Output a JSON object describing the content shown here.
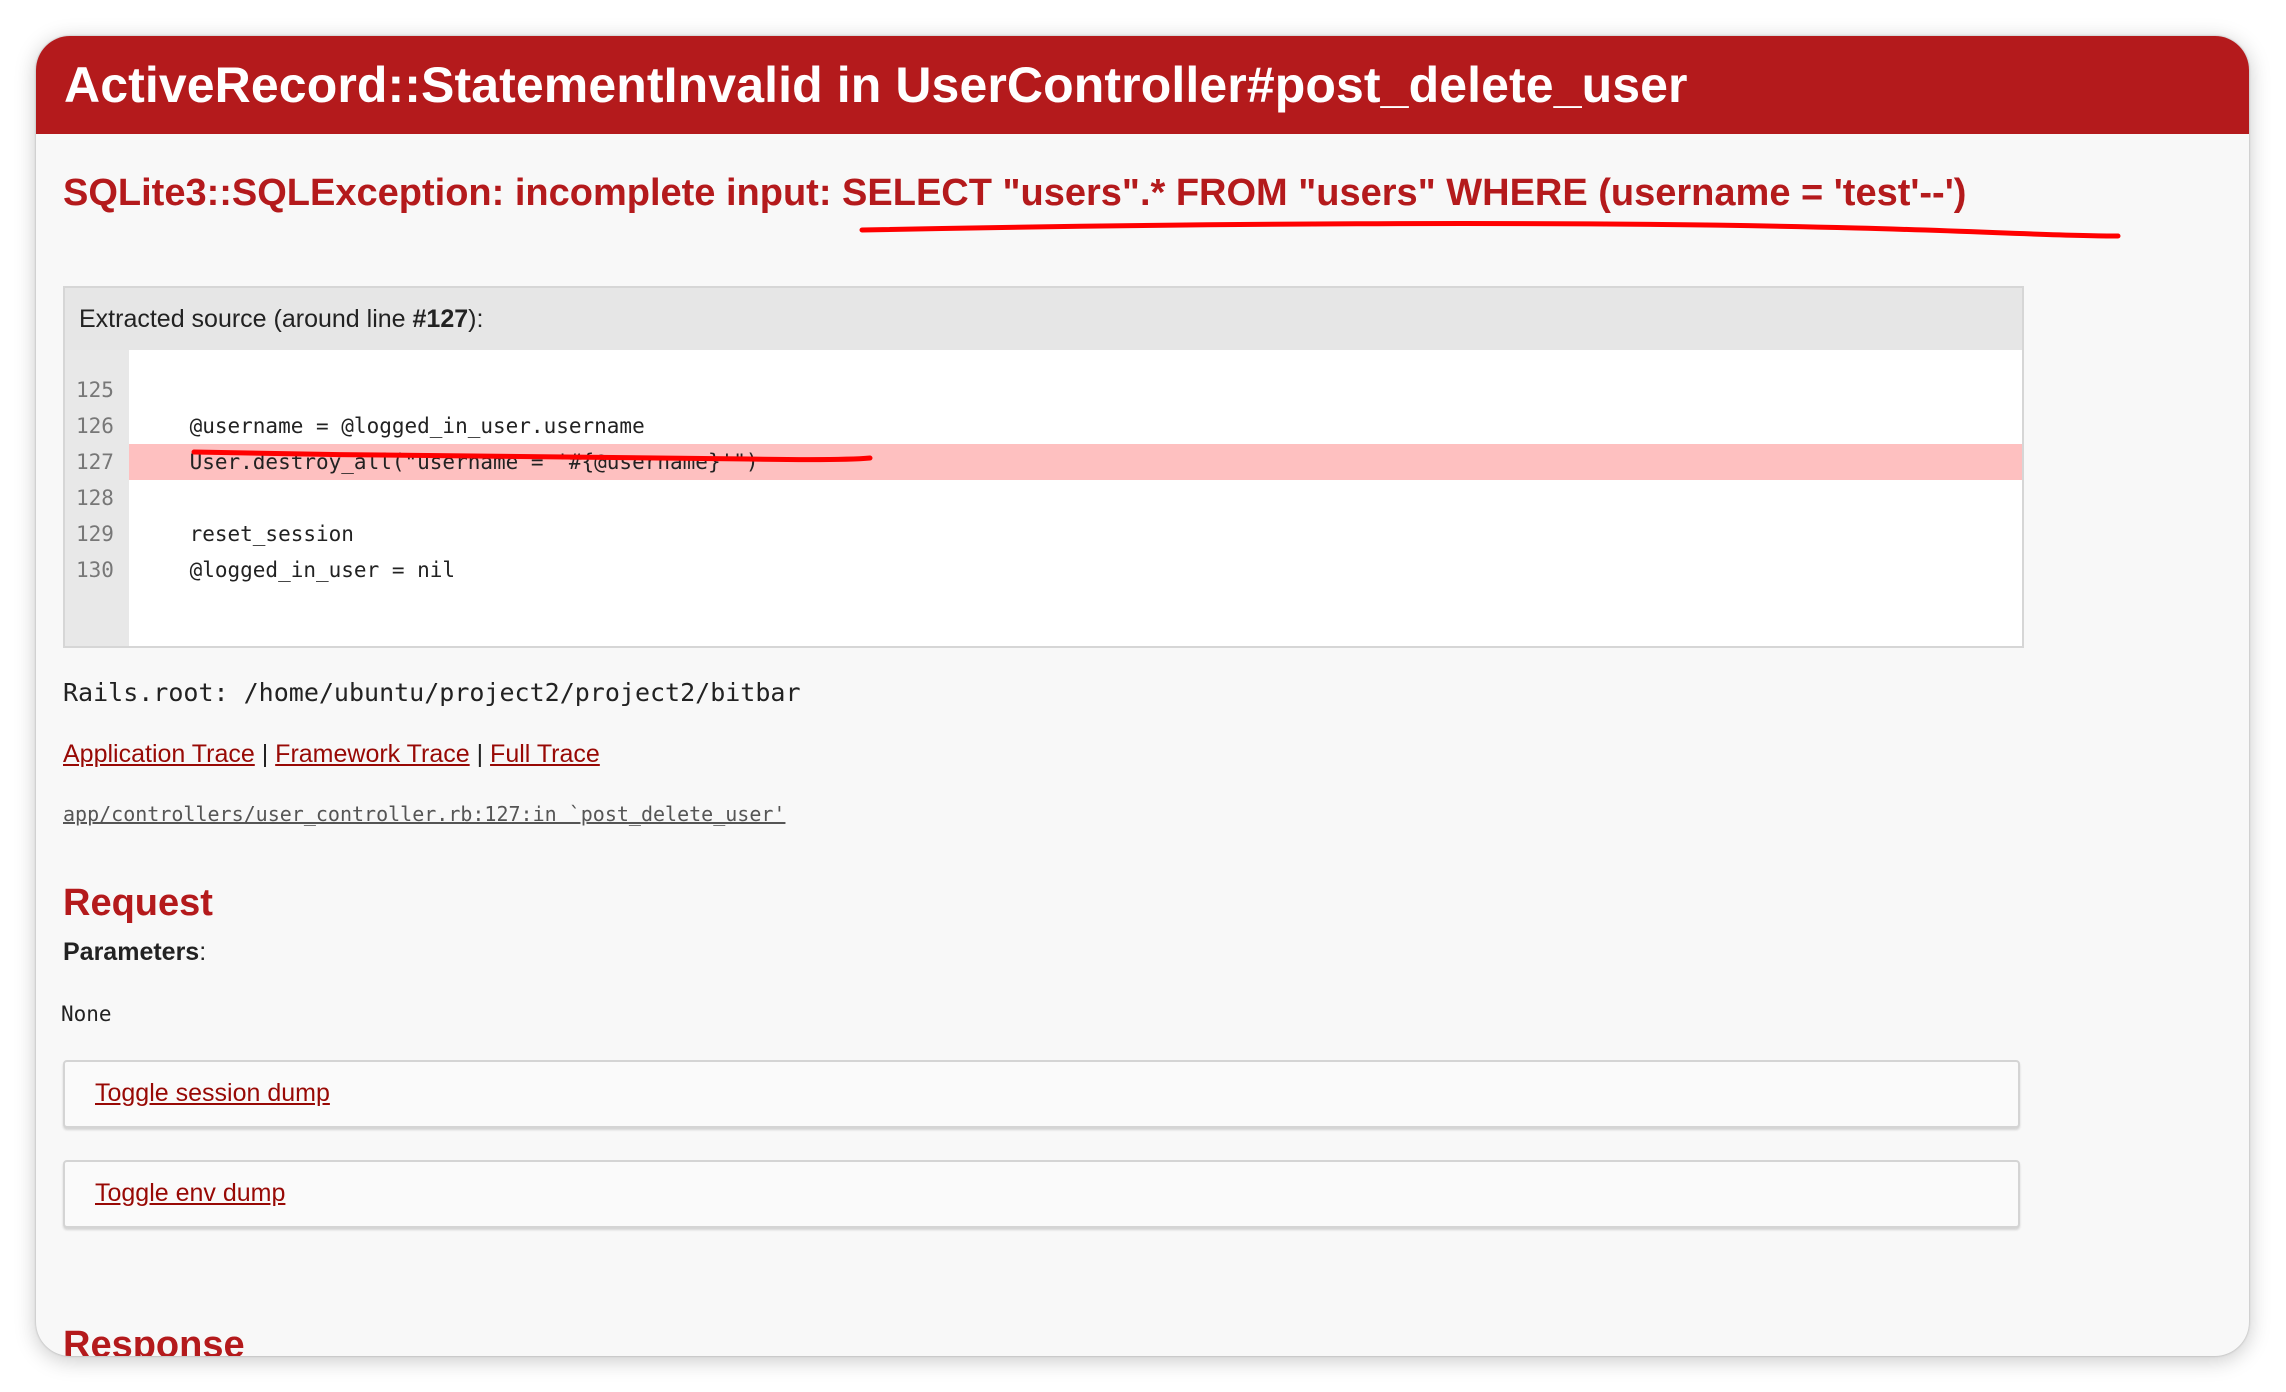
{
  "header": {
    "title": "ActiveRecord::StatementInvalid in UserController#post_delete_user"
  },
  "error": {
    "message_prefix": "SQLite3::SQLException: incomplete input: ",
    "message_query": "SELECT \"users\".* FROM \"users\" WHERE (username = 'test'--')"
  },
  "source": {
    "title_prefix": "Extracted source (around line ",
    "title_line": "#127",
    "title_suffix": "):",
    "lines": [
      {
        "number": "125",
        "code": ""
      },
      {
        "number": "126",
        "code": "    @username = @logged_in_user.username"
      },
      {
        "number": "127",
        "code": "    User.destroy_all(\"username = '#{@username}'\")"
      },
      {
        "number": "128",
        "code": ""
      },
      {
        "number": "129",
        "code": "    reset_session"
      },
      {
        "number": "130",
        "code": "    @logged_in_user = nil"
      }
    ],
    "highlighted_line": "127"
  },
  "rails_root": "Rails.root: /home/ubuntu/project2/project2/bitbar",
  "trace": {
    "application_label": "Application Trace",
    "framework_label": "Framework Trace",
    "full_label": "Full Trace",
    "separator": " | ",
    "line": "app/controllers/user_controller.rb:127:in `post_delete_user'"
  },
  "request": {
    "heading": "Request",
    "parameters_label": "Parameters",
    "parameters_colon": ":",
    "parameters_value": "None",
    "toggle_session_label": "Toggle session dump",
    "toggle_env_label": "Toggle env dump"
  },
  "response": {
    "heading": "Response"
  },
  "colors": {
    "header_bg": "#b41a1c",
    "error_text": "#b41a1c",
    "link": "#980905",
    "highlight_line": "#fec0c0",
    "annotation_underline": "#ff0000"
  }
}
